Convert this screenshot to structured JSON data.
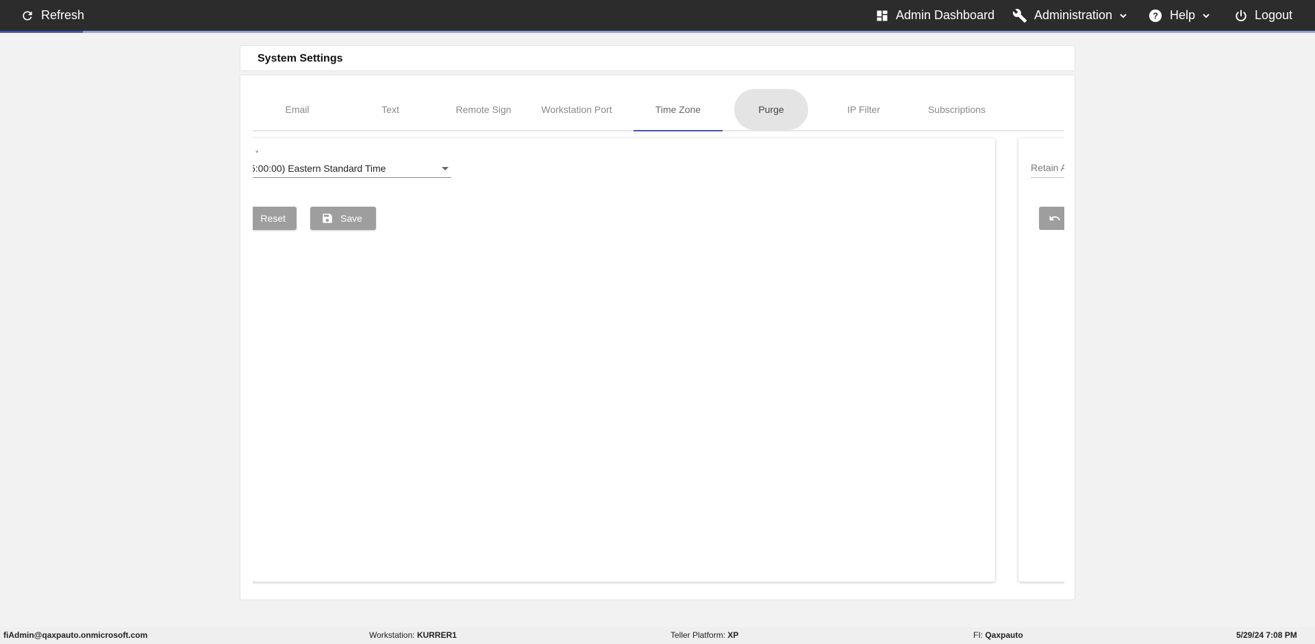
{
  "topbar": {
    "refresh_label": "Refresh",
    "admin_dashboard_label": "Admin Dashboard",
    "administration_label": "Administration",
    "help_label": "Help",
    "logout_label": "Logout",
    "background_color": "#2c2c2c",
    "accent_color": "#3f51b5"
  },
  "page": {
    "title": "System Settings"
  },
  "tabs": [
    {
      "label": "Email"
    },
    {
      "label": "Text"
    },
    {
      "label": "Remote Sign"
    },
    {
      "label": "Workstation Port"
    },
    {
      "label": "Time Zone",
      "state": "active"
    },
    {
      "label": "Purge",
      "state": "hover"
    },
    {
      "label": "IP Filter"
    },
    {
      "label": "Subscriptions"
    }
  ],
  "timezone_panel": {
    "field_label_fragment": ", *",
    "selected_value": "5:00:00) Eastern Standard Time",
    "reset_label": "Reset",
    "save_label": "Save"
  },
  "purge_panel": {
    "retain_placeholder": "Retain A"
  },
  "footer": {
    "user": "fiAdmin@qaxpauto.onmicrosoft.com",
    "workstation_label": "Workstation:",
    "workstation_value": "KURRER1",
    "teller_platform_label": "Teller Platform:",
    "teller_platform_value": "XP",
    "fi_label": "FI:",
    "fi_value": "Qaxpauto",
    "datetime": "5/29/24 7:08 PM"
  },
  "icons": {
    "refresh": "refresh-icon",
    "dashboard": "dashboard-icon",
    "wrench": "wrench-icon",
    "help": "help-circle-icon",
    "power": "power-icon",
    "save": "floppy-disk-icon",
    "undo": "undo-icon"
  }
}
